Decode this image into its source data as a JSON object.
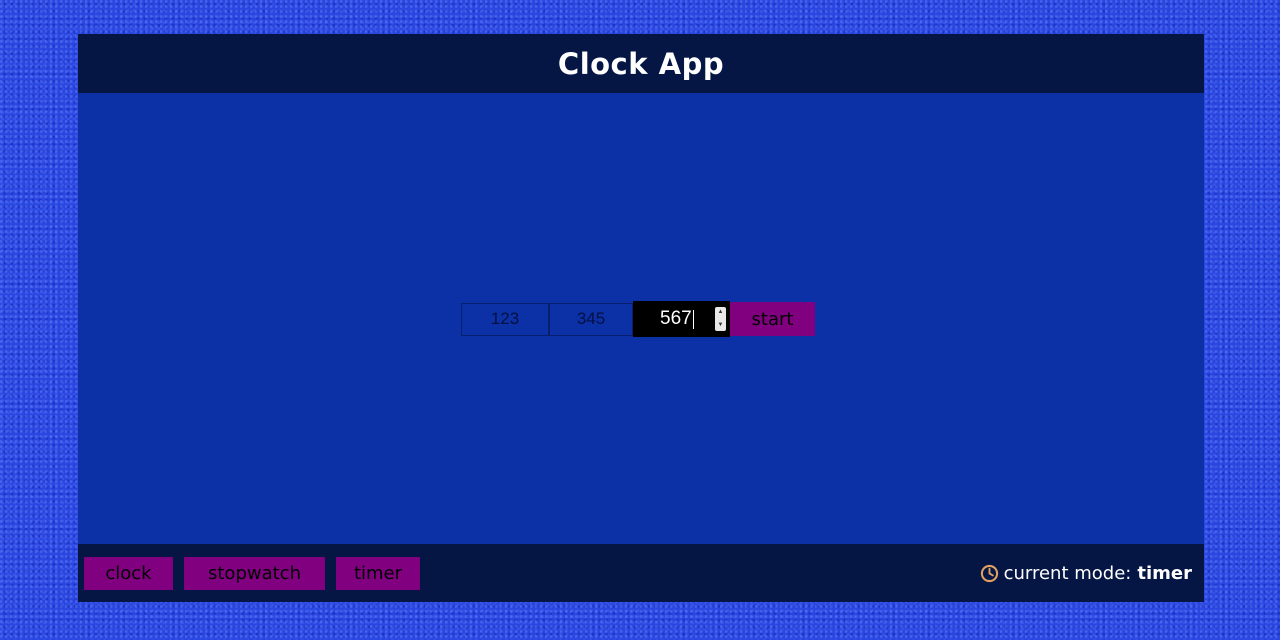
{
  "app": {
    "title": "Clock App"
  },
  "timer": {
    "hours_value": "123",
    "minutes_value": "345",
    "seconds_value": "567",
    "start_label": "start"
  },
  "footer": {
    "buttons": [
      {
        "label": "clock"
      },
      {
        "label": "stopwatch"
      },
      {
        "label": "timer"
      }
    ],
    "mode_label": "current mode:",
    "mode_value": "timer",
    "mode_icon": "clock-icon"
  },
  "colors": {
    "page_background": "#2a46e0",
    "panel": "#0c31a7",
    "header_footer": "#051645",
    "button": "#800080",
    "icon_accent": "#e0a060"
  }
}
